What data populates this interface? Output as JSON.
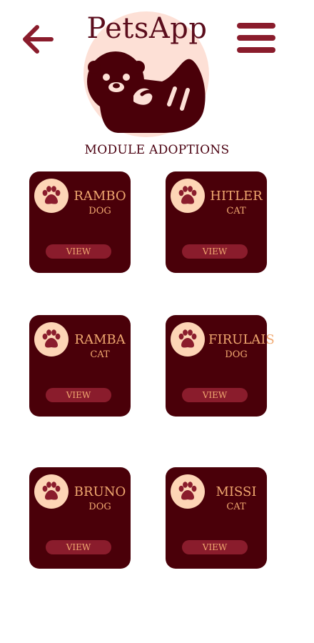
{
  "header": {
    "app_title": "PetsApp",
    "back_icon": "arrow-left-icon",
    "menu_icon": "hamburger-menu-icon",
    "logo_icon": "otter-logo"
  },
  "section": {
    "title": "MODULE ADOPTIONS"
  },
  "colors": {
    "primary": "#4a0009",
    "accent": "#8a1c2c",
    "text_accent": "#f0a870",
    "avatar_bg": "#fdd5b6",
    "logo_bg": "#fde0d6"
  },
  "pets": [
    {
      "name": "RAMBO",
      "type": "DOG",
      "view_label": "VIEW"
    },
    {
      "name": "HITLER",
      "type": "CAT",
      "view_label": "VIEW"
    },
    {
      "name": "RAMBA",
      "type": "CAT",
      "view_label": "VIEW"
    },
    {
      "name": "FIRULAIS",
      "type": "DOG",
      "view_label": "VIEW"
    },
    {
      "name": "BRUNO",
      "type": "DOG",
      "view_label": "VIEW"
    },
    {
      "name": "MISSI",
      "type": "CAT",
      "view_label": "VIEW"
    }
  ]
}
